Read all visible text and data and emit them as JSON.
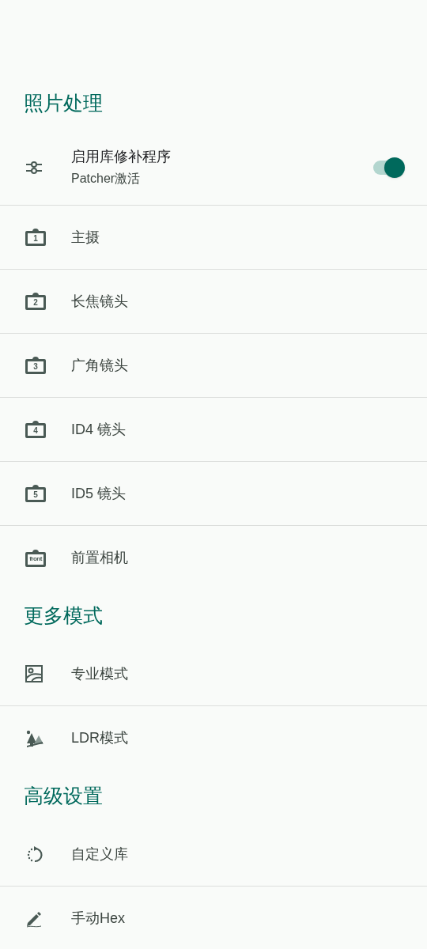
{
  "sections": [
    {
      "title": "照片处理",
      "items": [
        {
          "kind": "switch",
          "label": "启用库修补程序",
          "summary": "Patcher激活",
          "on": true
        },
        {
          "kind": "lens",
          "badge": "1",
          "label": "主摄"
        },
        {
          "kind": "lens",
          "badge": "2",
          "label": "长焦镜头"
        },
        {
          "kind": "lens",
          "badge": "3",
          "label": "广角镜头"
        },
        {
          "kind": "lens",
          "badge": "4",
          "label": "ID4 镜头"
        },
        {
          "kind": "lens",
          "badge": "5",
          "label": "ID5 镜头"
        },
        {
          "kind": "lens",
          "badge": "front",
          "label": "前置相机"
        }
      ]
    },
    {
      "title": "更多模式",
      "items": [
        {
          "kind": "plain",
          "label": "专业模式"
        },
        {
          "kind": "plain",
          "label": "LDR模式"
        }
      ]
    },
    {
      "title": "高级设置",
      "items": [
        {
          "kind": "plain",
          "label": "自定义库"
        },
        {
          "kind": "plain",
          "label": "手动Hex"
        }
      ]
    }
  ]
}
